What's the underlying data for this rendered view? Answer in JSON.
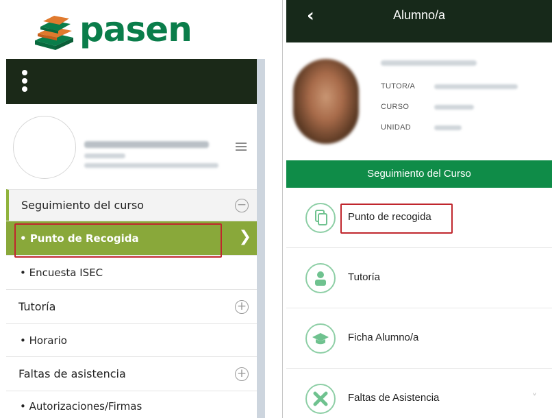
{
  "web": {
    "logo_text": "pasen",
    "menu": {
      "section_seguimiento": "Seguimiento del curso",
      "item_punto": "Punto de Recogida",
      "item_encuesta": "Encuesta ISEC",
      "section_tutoria": "Tutoría",
      "item_horario": "Horario",
      "section_faltas": "Faltas de asistencia",
      "item_autorizaciones": "Autorizaciones/Firmas"
    },
    "icons": {
      "collapse": "minus-circle-icon",
      "expand": "plus-circle-icon",
      "active_arrow": "chevron-right-icon",
      "menu_toggle": "kebab-icon",
      "profile_menu": "hamburger-icon"
    },
    "colors": {
      "brand_green": "#0a7d4a",
      "active_item": "#89a83a",
      "dark_bar": "#1b2918",
      "highlight": "#c0262d"
    }
  },
  "app": {
    "header_title": "Alumno/a",
    "back_icon": "chevron-left-icon",
    "card": {
      "label_tutor": "TUTOR/A",
      "label_curso": "CURSO",
      "label_unidad": "UNIDAD"
    },
    "section_title": "Seguimiento del Curso",
    "rows": [
      {
        "label": "Punto de recogida",
        "icon": "documents-icon"
      },
      {
        "label": "Tutoría",
        "icon": "person-icon"
      },
      {
        "label": "Ficha Alumno/a",
        "icon": "graduation-cap-icon"
      },
      {
        "label": "Faltas de Asistencia",
        "icon": "x-mark-icon",
        "chevron": "˅"
      }
    ],
    "colors": {
      "header": "#17291a",
      "band": "#0f8c48",
      "icon_ring": "#8ecfa6"
    }
  }
}
